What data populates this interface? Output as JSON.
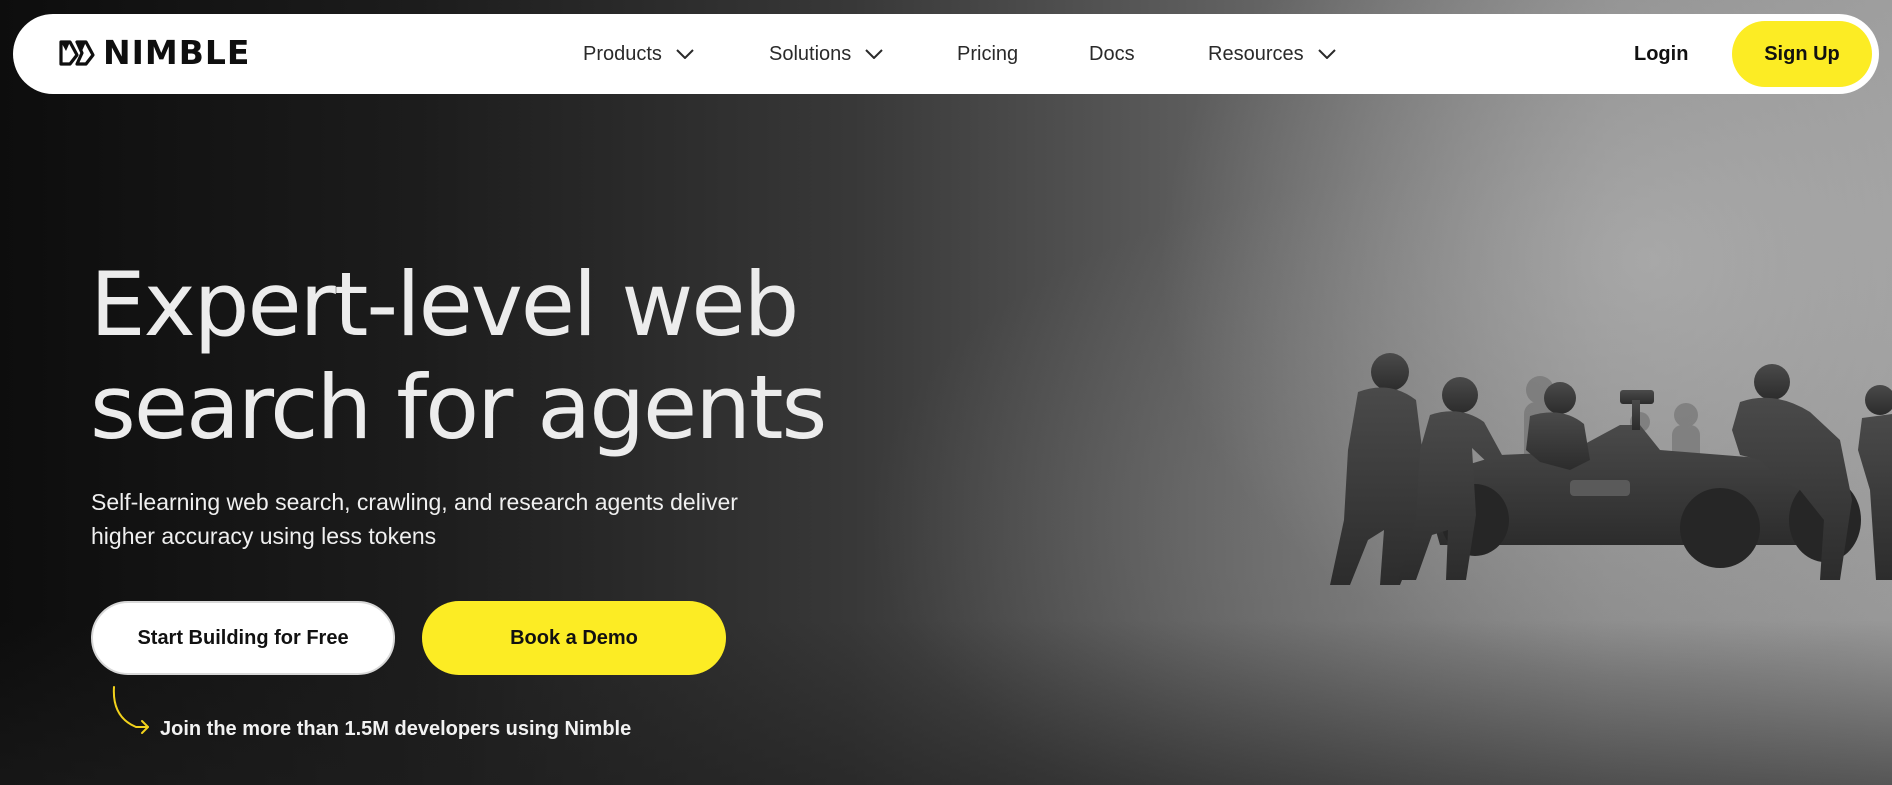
{
  "nav": {
    "logo_text": "NIMBLE",
    "items": [
      {
        "label": "Products",
        "has_dropdown": true
      },
      {
        "label": "Solutions",
        "has_dropdown": true
      },
      {
        "label": "Pricing",
        "has_dropdown": false
      },
      {
        "label": "Docs",
        "has_dropdown": false
      },
      {
        "label": "Resources",
        "has_dropdown": true
      }
    ],
    "login_label": "Login",
    "signup_label": "Sign Up"
  },
  "hero": {
    "headline_line1": "Expert-level web",
    "headline_line2": "search for agents",
    "subtext_line1": "Self-learning web search, crawling, and research agents deliver",
    "subtext_line2": "higher accuracy using less tokens",
    "primary_cta": "Start Building for Free",
    "secondary_cta": "Book a Demo",
    "social_proof": "Join the more than 1.5M developers using Nimble"
  },
  "colors": {
    "accent": "#fcec24",
    "nav_bg": "#ffffff",
    "hero_text": "#ececec"
  },
  "icons": {
    "logo_mark": "nimble-logo-icon",
    "dropdown": "chevron-down-icon",
    "join_arrow": "curved-arrow-icon"
  }
}
